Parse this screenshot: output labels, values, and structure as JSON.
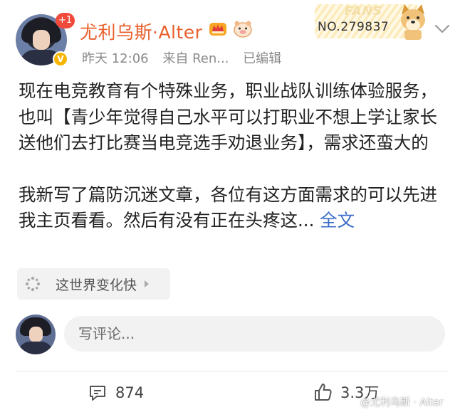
{
  "author": {
    "name": "尤利乌斯·Alter",
    "notification_badge": "+1",
    "verified_badge": "V"
  },
  "meta": {
    "time": "昨天 12:06",
    "source": "来自 Ren...",
    "edited": "已编辑"
  },
  "fans_card": {
    "word": "FANS",
    "number": "NO.279837"
  },
  "post": {
    "paragraph1": "现在电竞教育有个特殊业务，职业战队训练体验服务，也叫【青少年觉得自己水平可以打职业不想上学让家长送他们去打比赛当电竞选手劝退业务】，需求还蛮大的",
    "paragraph2_text": "我新写了篇防沉迷文章，各位有这方面需求的可以先进我主页看看。然后有没有正在头疼这...",
    "full_text_link": "全文"
  },
  "topic": {
    "label": "这世界变化快"
  },
  "comment_box": {
    "placeholder": "写评论..."
  },
  "actions": {
    "comment_count": "874",
    "like_count": "3.3万"
  },
  "watermark": "@尤利乌斯 · Alter",
  "colors": {
    "username": "#e8602c",
    "link": "#3b6cc7",
    "meta": "#8a8a8a",
    "badge_red": "#f04a3b",
    "verify_gold": "#f7b500"
  },
  "icons": {
    "crown": "crown-icon",
    "pet": "pig-face-icon",
    "doge": "doge-icon",
    "more": "chevron-down-icon",
    "topic": "sparkle-icon",
    "comment": "comment-bubble-icon",
    "like": "thumbs-up-icon"
  }
}
